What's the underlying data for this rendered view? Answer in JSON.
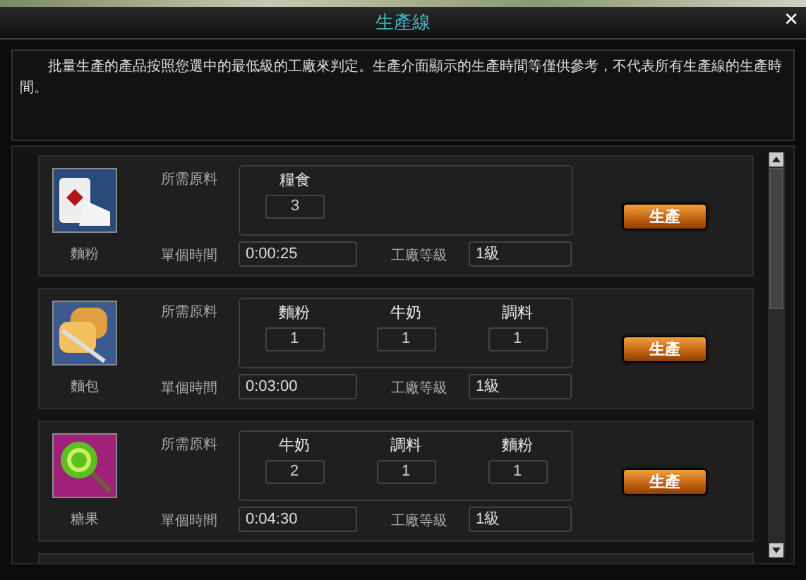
{
  "window": {
    "title": "生產線",
    "close": "✕"
  },
  "notice": "批量生產的產品按照您選中的最低級的工廠來判定。生產介面顯示的生產時間等僅供參考，不代表所有生產線的生產時間。",
  "products": [
    {
      "name": "麵粉",
      "kind": "sack",
      "materials_label": "所需原料",
      "materials": [
        {
          "name": "糧食",
          "count": "3"
        }
      ],
      "time_label": "單個時間",
      "time": "0:00:25",
      "level_label": "工廠等級",
      "level_value": "1級",
      "button": "生產"
    },
    {
      "name": "麵包",
      "kind": "bread",
      "materials_label": "所需原料",
      "materials": [
        {
          "name": "麵粉",
          "count": "1"
        },
        {
          "name": "牛奶",
          "count": "1"
        },
        {
          "name": "調料",
          "count": "1"
        }
      ],
      "time_label": "單個時間",
      "time": "0:03:00",
      "level_label": "工廠等級",
      "level_value": "1級",
      "button": "生產"
    },
    {
      "name": "糖果",
      "kind": "candy",
      "materials_label": "所需原料",
      "materials": [
        {
          "name": "牛奶",
          "count": "2"
        },
        {
          "name": "調料",
          "count": "1"
        },
        {
          "name": "麵粉",
          "count": "1"
        }
      ],
      "time_label": "單個時間",
      "time": "0:04:30",
      "level_label": "工廠等級",
      "level_value": "1級",
      "button": "生產"
    }
  ]
}
